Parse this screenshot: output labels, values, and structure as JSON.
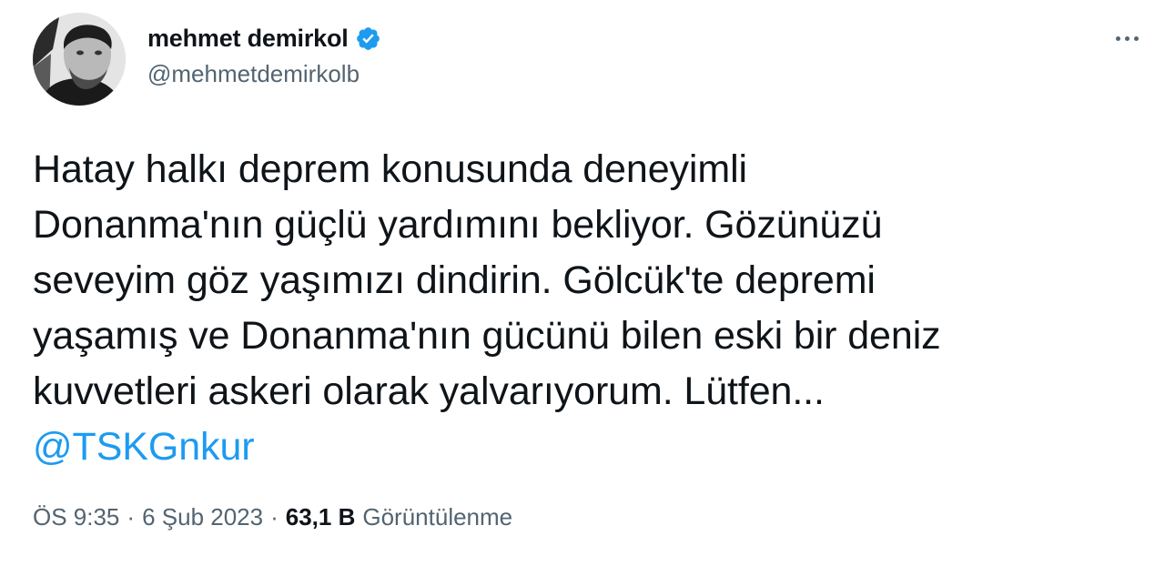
{
  "author": {
    "display_name": "mehmet demirkol",
    "handle": "@mehmetdemirkolb",
    "verified_icon": "verified-badge-icon",
    "avatar": "profile-photo"
  },
  "menu": {
    "more_icon": "more-options-icon"
  },
  "tweet": {
    "lines": [
      "Hatay halkı deprem konusunda deneyimli",
      "Donanma'nın güçlü yardımını bekliyor. Gözünüzü",
      "seveyim göz yaşımızı dindirin. Gölcük'te depremi",
      "yaşamış ve Donanma'nın gücünü bilen eski bir deniz",
      "kuvvetleri askeri olarak yalvarıyorum. Lütfen..."
    ],
    "mention": "@TSKGnkur"
  },
  "meta": {
    "time": "ÖS 9:35",
    "separator": "·",
    "date": "6 Şub 2023",
    "views_count": "63,1 B",
    "views_label": "Görüntülenme"
  },
  "colors": {
    "accent": "#1d9bf0",
    "text_primary": "#0f1419",
    "text_secondary": "#536471"
  }
}
